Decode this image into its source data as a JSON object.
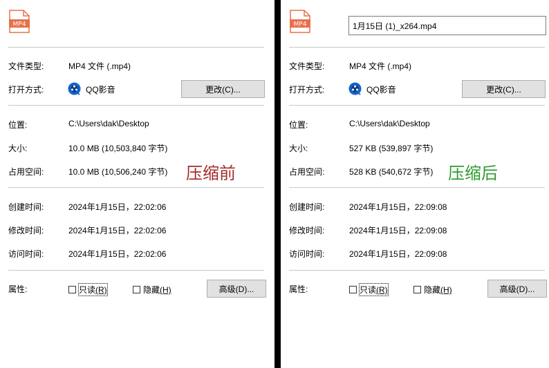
{
  "left": {
    "icon_label": "MP4",
    "file_type_label": "文件类型:",
    "file_type_value": "MP4 文件 (.mp4)",
    "open_with_label": "打开方式:",
    "open_with_app": "QQ影音",
    "change_button": "更改(C)...",
    "location_label": "位置:",
    "location_value": "C:\\Users\\dak\\Desktop",
    "size_label": "大小:",
    "size_value": "10.0 MB (10,503,840 字节)",
    "size_on_disk_label": "占用空间:",
    "size_on_disk_value": "10.0 MB (10,506,240 字节)",
    "annotation": "压缩前",
    "created_label": "创建时间:",
    "created_value": "2024年1月15日，22:02:06",
    "modified_label": "修改时间:",
    "modified_value": "2024年1月15日，22:02:06",
    "accessed_label": "访问时间:",
    "accessed_value": "2024年1月15日，22:02:06",
    "attributes_label": "属性:",
    "readonly_text": "只读",
    "readonly_key": "(R)",
    "hidden_text": "隐藏",
    "hidden_key": "(H)",
    "advanced_button": "高级(D)..."
  },
  "right": {
    "icon_label": "MP4",
    "file_name_value": "1月15日 (1)_x264.mp4",
    "file_type_label": "文件类型:",
    "file_type_value": "MP4 文件 (.mp4)",
    "open_with_label": "打开方式:",
    "open_with_app": "QQ影音",
    "change_button": "更改(C)...",
    "location_label": "位置:",
    "location_value": "C:\\Users\\dak\\Desktop",
    "size_label": "大小:",
    "size_value": "527 KB (539,897 字节)",
    "size_on_disk_label": "占用空间:",
    "size_on_disk_value": "528 KB (540,672 字节)",
    "annotation": "压缩后",
    "created_label": "创建时间:",
    "created_value": "2024年1月15日，22:09:08",
    "modified_label": "修改时间:",
    "modified_value": "2024年1月15日，22:09:08",
    "accessed_label": "访问时间:",
    "accessed_value": "2024年1月15日，22:09:08",
    "attributes_label": "属性:",
    "readonly_text": "只读",
    "readonly_key": "(R)",
    "hidden_text": "隐藏",
    "hidden_key": "(H)",
    "advanced_button": "高级(D)..."
  },
  "colors": {
    "icon_orange": "#e8704b",
    "annotation_before": "#a52a2a",
    "annotation_after": "#2e9a2e",
    "app_icon_blue": "#1464c8"
  },
  "icons": [
    "mp4-file-icon",
    "qq-player-icon",
    "checkbox"
  ]
}
